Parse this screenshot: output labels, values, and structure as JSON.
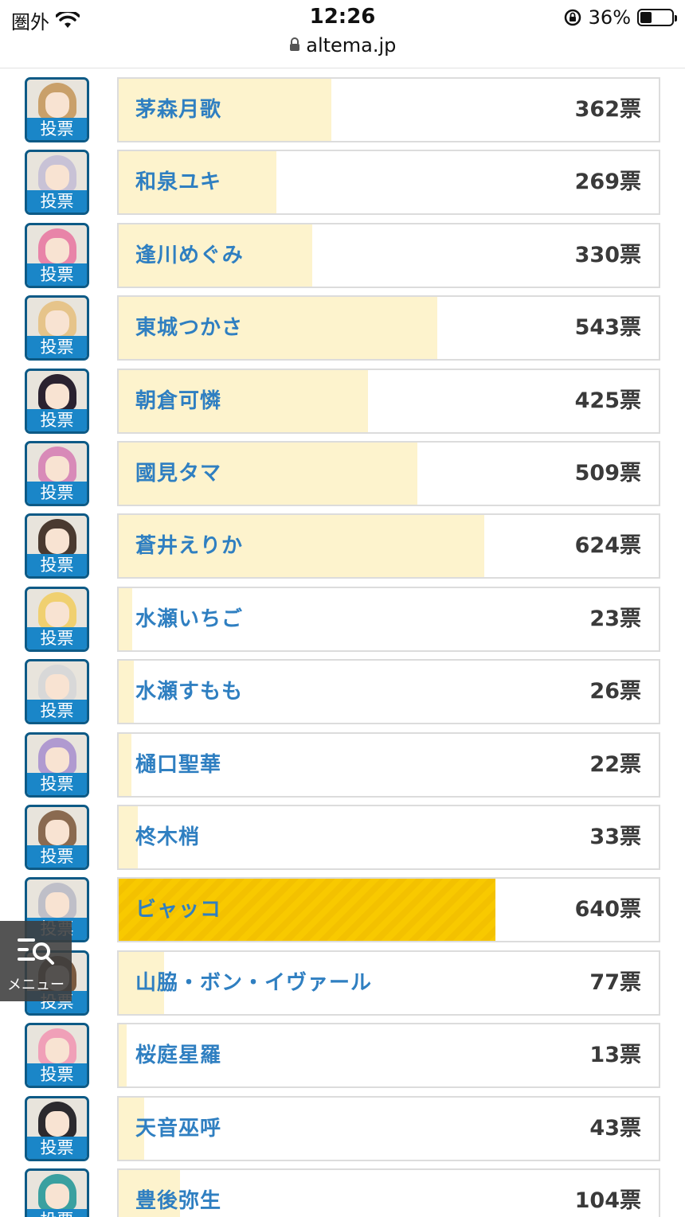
{
  "status_bar": {
    "carrier": "圏外",
    "time": "12:26",
    "url": "altema.jp",
    "battery": "36%",
    "battery_level": 0.36,
    "icons": [
      "wifi-icon",
      "lock-icon",
      "rotation-lock-icon",
      "battery-icon"
    ]
  },
  "vote_label": "投票",
  "menu": {
    "label": "メニュー",
    "icon": "search-list-icon"
  },
  "candidates": [
    {
      "name": "茅森月歌",
      "votes": "362票",
      "count": 362,
      "hair": "#c9a06a"
    },
    {
      "name": "和泉ユキ",
      "votes": "269票",
      "count": 269,
      "hair": "#c8c2d6"
    },
    {
      "name": "逢川めぐみ",
      "votes": "330票",
      "count": 330,
      "hair": "#e884a8"
    },
    {
      "name": "東城つかさ",
      "votes": "543票",
      "count": 543,
      "hair": "#e6c48a"
    },
    {
      "name": "朝倉可憐",
      "votes": "425票",
      "count": 425,
      "hair": "#2a2230"
    },
    {
      "name": "國見タマ",
      "votes": "509票",
      "count": 509,
      "hair": "#d88ab8"
    },
    {
      "name": "蒼井えりか",
      "votes": "624票",
      "count": 624,
      "hair": "#4a3a30"
    },
    {
      "name": "水瀬いちご",
      "votes": "23票",
      "count": 23,
      "hair": "#f0d070"
    },
    {
      "name": "水瀬すもも",
      "votes": "26票",
      "count": 26,
      "hair": "#d8d8d8"
    },
    {
      "name": "樋口聖華",
      "votes": "22票",
      "count": 22,
      "hair": "#b09ad0"
    },
    {
      "name": "柊木梢",
      "votes": "33票",
      "count": 33,
      "hair": "#8a6a50"
    },
    {
      "name": "ビャッコ",
      "votes": "640票",
      "count": 640,
      "hair": "#bfbfc8",
      "top": true
    },
    {
      "name": "山脇・ボン・イヴァール",
      "votes": "77票",
      "count": 77,
      "hair": "#7a5a40"
    },
    {
      "name": "桜庭星羅",
      "votes": "13票",
      "count": 13,
      "hair": "#f0a0b8"
    },
    {
      "name": "天音巫呼",
      "votes": "43票",
      "count": 43,
      "hair": "#2c2a2e"
    },
    {
      "name": "豊後弥生",
      "votes": "104票",
      "count": 104,
      "hair": "#3aa0a0"
    }
  ],
  "max_votes": 640,
  "colors": {
    "fill": "#fdf3cd",
    "top_fill": "#f8c900",
    "name": "#2f7fc1",
    "badge": "#1a86c8",
    "avatar_border": "#0d5a86"
  }
}
